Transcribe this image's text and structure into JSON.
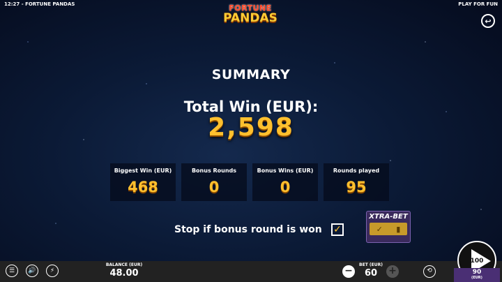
{
  "topbar": {
    "time": "12:27",
    "title": "FORTUNE PANDAS",
    "mode": "PLAY FOR FUN"
  },
  "logo": {
    "line1": "FORTUNE",
    "line2": "PANDAS"
  },
  "summary": {
    "title": "SUMMARY",
    "total_win_label": "Total Win (EUR):",
    "total_win_value": "2,598",
    "stats": [
      {
        "label": "Biggest Win (EUR)",
        "value": "468"
      },
      {
        "label": "Bonus Rounds",
        "value": "0"
      },
      {
        "label": "Bonus Wins (EUR)",
        "value": "0"
      },
      {
        "label": "Rounds played",
        "value": "95"
      }
    ]
  },
  "stop": {
    "label": "Stop if bonus round is won",
    "checked": true
  },
  "xtra_bet": {
    "label": "XTRA-BET",
    "enabled": true
  },
  "bottombar": {
    "balance_label": "BALANCE (EUR)",
    "balance_value": "48.00",
    "bet_label": "BET (EUR)",
    "bet_value": "60",
    "spin_count": "100",
    "autoplay_remaining": "90",
    "autoplay_currency": "(EUR)"
  },
  "colors": {
    "accent": "#ffc02e",
    "xtra_bg": "#3a2a5c",
    "autoplay_bg": "#4a2f74"
  },
  "icons": [
    "menu-icon",
    "sound-icon",
    "lightning-icon",
    "back-icon",
    "autoplay-icon",
    "checkmark-icon"
  ]
}
